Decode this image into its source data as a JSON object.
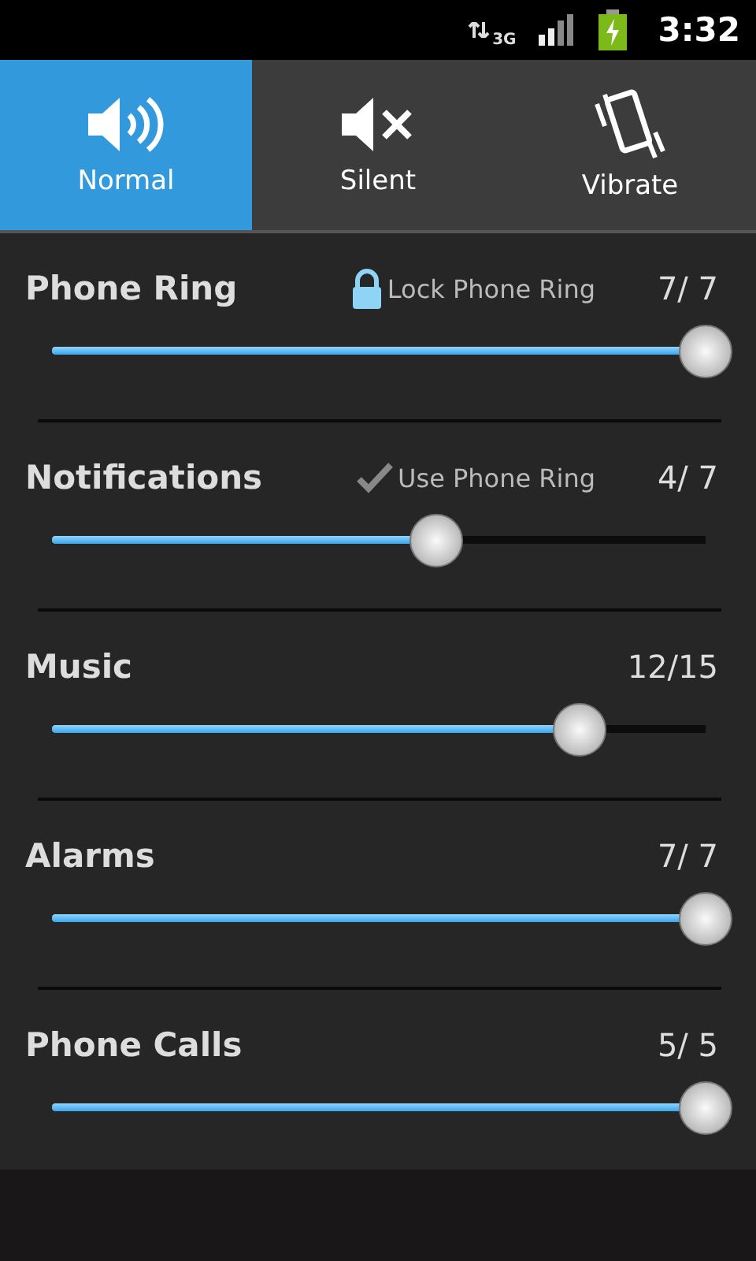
{
  "status_bar": {
    "network": "3G",
    "time": "3:32"
  },
  "modes": [
    {
      "label": "Normal",
      "kind": "sound",
      "selected": true
    },
    {
      "label": "Silent",
      "kind": "mute",
      "selected": false
    },
    {
      "label": "Vibrate",
      "kind": "vibrate",
      "selected": false
    }
  ],
  "volumes": [
    {
      "name": "Phone Ring",
      "option": {
        "kind": "lock",
        "label": "Lock Phone Ring",
        "checked": true
      },
      "reading": "7/ 7",
      "level": 1
    },
    {
      "name": "Notifications",
      "option": {
        "kind": "check",
        "label": "Use Phone Ring",
        "checked": false
      },
      "reading": "4/ 7",
      "level": 0.571
    },
    {
      "name": "Music",
      "reading": "12/15",
      "level": 0.8
    },
    {
      "name": "Alarms",
      "reading": "7/ 7",
      "level": 1
    },
    {
      "name": "Phone Calls",
      "reading": "5/ 5",
      "level": 1
    }
  ]
}
